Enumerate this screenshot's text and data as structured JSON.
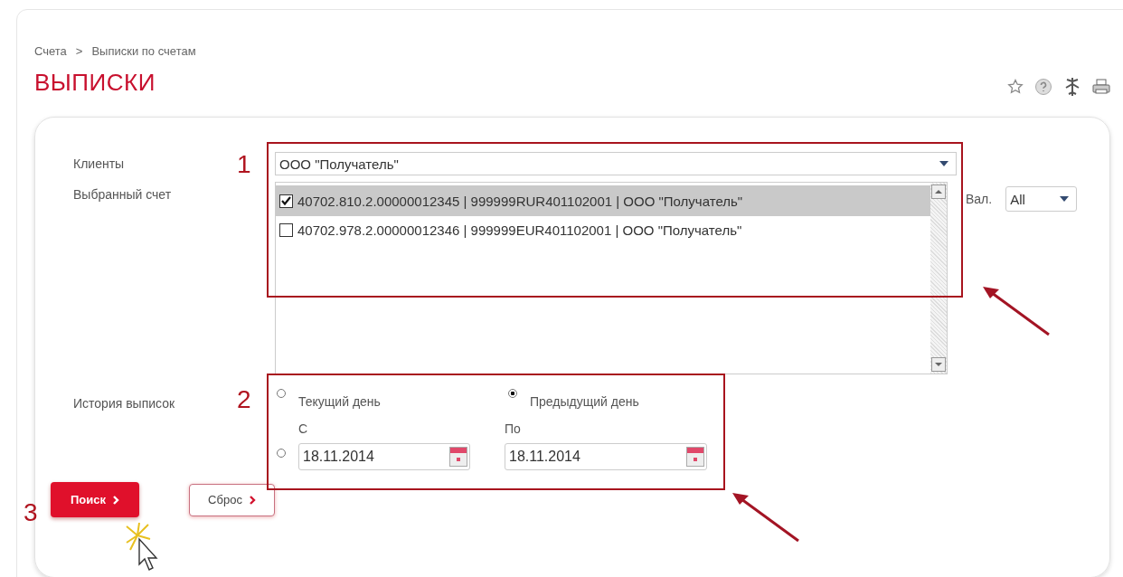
{
  "breadcrumb": [
    {
      "label": "Счета"
    },
    {
      "label": ">"
    },
    {
      "label": "Выписки по счетам"
    }
  ],
  "title": "ВЫПИСКИ",
  "form": {
    "clients": {
      "label": "Клиенты",
      "value": "ООО \"Получатель\""
    },
    "account": {
      "label": "Выбранный счет",
      "items": [
        {
          "text": "40702.810.2.00000012345 | 999999RUR401102001 | ООО \"Получатель\"",
          "checked": true,
          "selected": true
        },
        {
          "text": "40702.978.2.00000012346 | 999999EUR401102001 | ООО \"Получатель\"",
          "checked": false,
          "selected": false
        }
      ]
    },
    "currency": {
      "label": "Вал.",
      "value": "All"
    },
    "history": {
      "label": "История выписок",
      "options": [
        {
          "kind": "day",
          "label": "Текущий день",
          "selected": false
        },
        {
          "kind": "day",
          "label": "Предыдущий день",
          "selected": true
        },
        {
          "kind": "range",
          "selected": false,
          "from_label": "С",
          "from_value": "18.11.2014",
          "to_label": "По",
          "to_value": "18.11.2014"
        }
      ]
    }
  },
  "buttons": [
    {
      "kind": "primary",
      "label": "Поиск"
    },
    {
      "kind": "secondary",
      "label": "Сброс"
    }
  ],
  "annotations": [
    {
      "number": "1"
    },
    {
      "number": "2"
    },
    {
      "number": "3"
    }
  ]
}
